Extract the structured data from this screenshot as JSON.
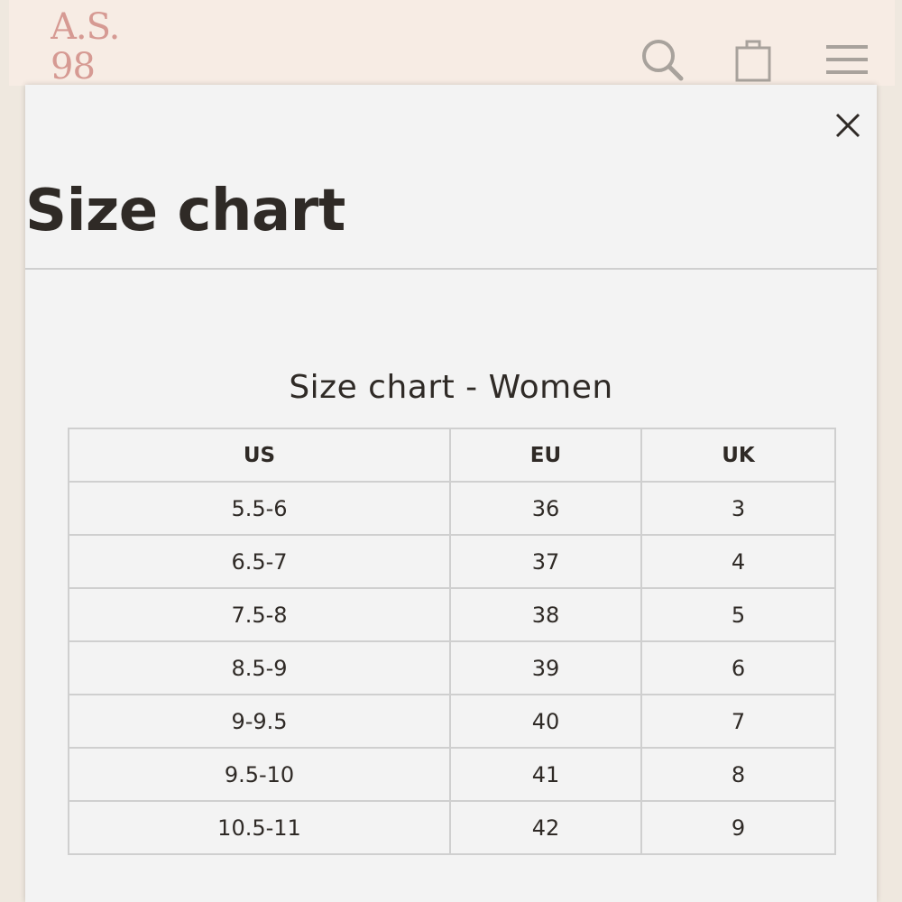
{
  "header": {
    "logo_line1": "A.S.",
    "logo_line2": "98",
    "icons": [
      "search-icon",
      "shopping-bag-icon",
      "hamburger-menu-icon"
    ]
  },
  "modal": {
    "title": "Size chart",
    "close_icon": "close-icon"
  },
  "size_chart": {
    "heading": "Size chart - Women",
    "columns": [
      "US",
      "EU",
      "UK"
    ],
    "rows": [
      [
        "5.5-6",
        "36",
        "3"
      ],
      [
        "6.5-7",
        "37",
        "4"
      ],
      [
        "7.5-8",
        "38",
        "5"
      ],
      [
        "8.5-9",
        "39",
        "6"
      ],
      [
        "9-9.5",
        "40",
        "7"
      ],
      [
        "9.5-10",
        "41",
        "8"
      ],
      [
        "10.5-11",
        "42",
        "9"
      ]
    ]
  },
  "colors": {
    "logo": "#d69a93",
    "header_bg": "#f7ece4",
    "modal_bg": "#f3f3f3",
    "text": "#2f2a26",
    "border": "#cfcfcf",
    "icon": "#a8a29c"
  }
}
